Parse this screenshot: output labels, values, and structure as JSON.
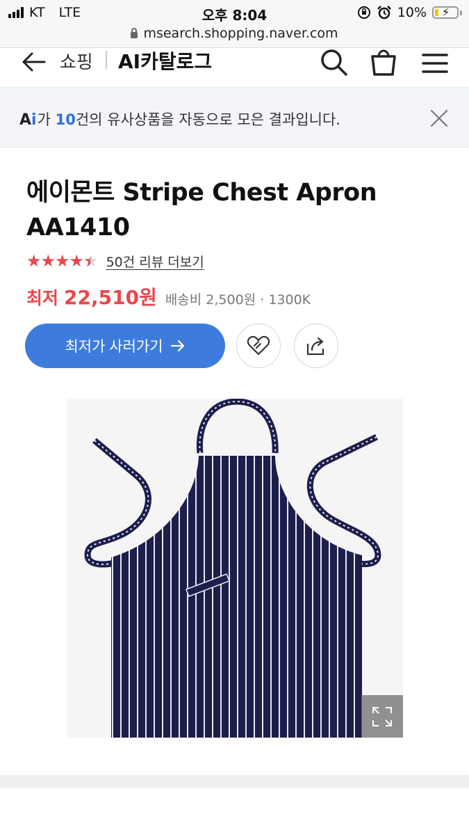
{
  "status_bar": {
    "carrier": "KT",
    "network": "LTE",
    "time": "오후 8:04",
    "battery_percent": "10%"
  },
  "browser": {
    "url": "msearch.shopping.naver.com"
  },
  "nav": {
    "shopping_label": "쇼핑",
    "catalog_label": "AI카탈로그",
    "icons": [
      "back-arrow-icon",
      "search-icon",
      "cart-icon",
      "menu-icon"
    ]
  },
  "ai_banner": {
    "logo": "Ai",
    "text_before": "가 ",
    "count": "10",
    "text_after": "건의 유사상품을 자동으로 모은 결과입니다."
  },
  "product": {
    "title": "에이몬트 Stripe Chest Apron AA1410",
    "rating": 4.5,
    "rating_max": 5,
    "review_link": "50건 리뷰 더보기",
    "price_label": "최저",
    "price": "22,510원",
    "shipping": "배송비 2,500원",
    "separator": "·",
    "seller": "1300K",
    "buy_button_label": "최저가 사러가기",
    "colors": {
      "accent": "#3d7bdd",
      "price": "#e8474d",
      "apron_navy": "#1c1e4c"
    }
  }
}
